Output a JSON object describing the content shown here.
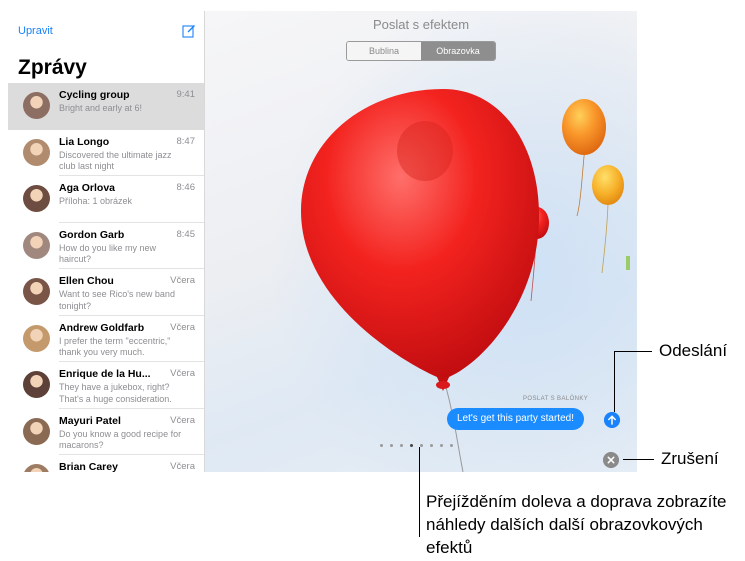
{
  "sidebar": {
    "edit_label": "Upravit",
    "title": "Zprávy",
    "compose_icon": "compose-icon",
    "conversations": [
      {
        "name": "Cycling group",
        "time": "9:41",
        "preview": "Bright and early at 6!",
        "selected": true
      },
      {
        "name": "Lia Longo",
        "time": "8:47",
        "preview": "Discovered the ultimate jazz club last night"
      },
      {
        "name": "Aga Orlova",
        "time": "8:46",
        "preview": "Příloha: 1 obrázek"
      },
      {
        "name": "Gordon Garb",
        "time": "8:45",
        "preview": "How do you like my new haircut?"
      },
      {
        "name": "Ellen Chou",
        "time": "Včera",
        "preview": "Want to see Rico's new band tonight?"
      },
      {
        "name": "Andrew Goldfarb",
        "time": "Včera",
        "preview": "I prefer the term \"eccentric,\" thank you very much."
      },
      {
        "name": "Enrique de la Hu...",
        "time": "Včera",
        "preview": "They have a jukebox, right? That's a huge consideration."
      },
      {
        "name": "Mayuri Patel",
        "time": "Včera",
        "preview": "Do you know a good recipe for macarons?"
      },
      {
        "name": "Brian Carey",
        "time": "Včera",
        "preview": ""
      }
    ]
  },
  "effect": {
    "title": "Poslat s efektem",
    "tabs": [
      "Bublina",
      "Obrazovka"
    ],
    "active_tab": "Obrazovka",
    "effect_tag": "POSLAT S BALÓNKY",
    "message": "Let's get this party started!",
    "page_count": 8,
    "active_page": 3
  },
  "callouts": {
    "send": "Odeslání",
    "cancel": "Zrušení",
    "swipe": "Přejížděním doleva a doprava zobrazíte náhledy dalších další obrazovkových efektů"
  },
  "colors": {
    "accent": "#1a82fb",
    "balloon_red": "#f0201e",
    "balloon_orange": "#f6a021"
  }
}
